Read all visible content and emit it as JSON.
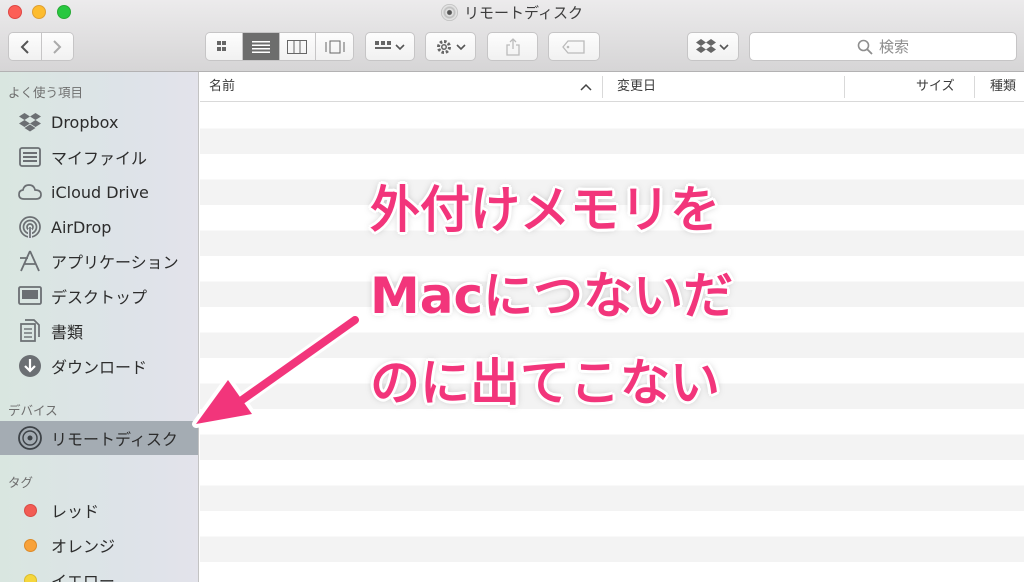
{
  "window": {
    "title": "リモートディスク"
  },
  "toolbar": {
    "search_placeholder": "検索"
  },
  "sidebar": {
    "favorites_header": "よく使う項目",
    "favorites": [
      {
        "label": "Dropbox",
        "icon": "dropbox-icon"
      },
      {
        "label": "マイファイル",
        "icon": "all-my-files-icon"
      },
      {
        "label": "iCloud Drive",
        "icon": "cloud-icon"
      },
      {
        "label": "AirDrop",
        "icon": "airdrop-icon"
      },
      {
        "label": "アプリケーション",
        "icon": "applications-icon"
      },
      {
        "label": "デスクトップ",
        "icon": "desktop-icon"
      },
      {
        "label": "書類",
        "icon": "documents-icon"
      },
      {
        "label": "ダウンロード",
        "icon": "downloads-icon"
      }
    ],
    "devices_header": "デバイス",
    "devices": [
      {
        "label": "リモートディスク",
        "icon": "remote-disc-icon",
        "selected": true
      }
    ],
    "tags_header": "タグ",
    "tags": [
      {
        "label": "レッド",
        "color": "#f25c54"
      },
      {
        "label": "オレンジ",
        "color": "#f8a23a"
      },
      {
        "label": "イエロー",
        "color": "#f5d63c"
      }
    ]
  },
  "columns": {
    "name": "名前",
    "modified": "変更日",
    "size": "サイズ",
    "kind": "種類"
  },
  "annotation": {
    "line1": "外付けメモリを",
    "line2": "Macにつないだ",
    "line3": "のに出てこない",
    "color": "#f2357b"
  }
}
